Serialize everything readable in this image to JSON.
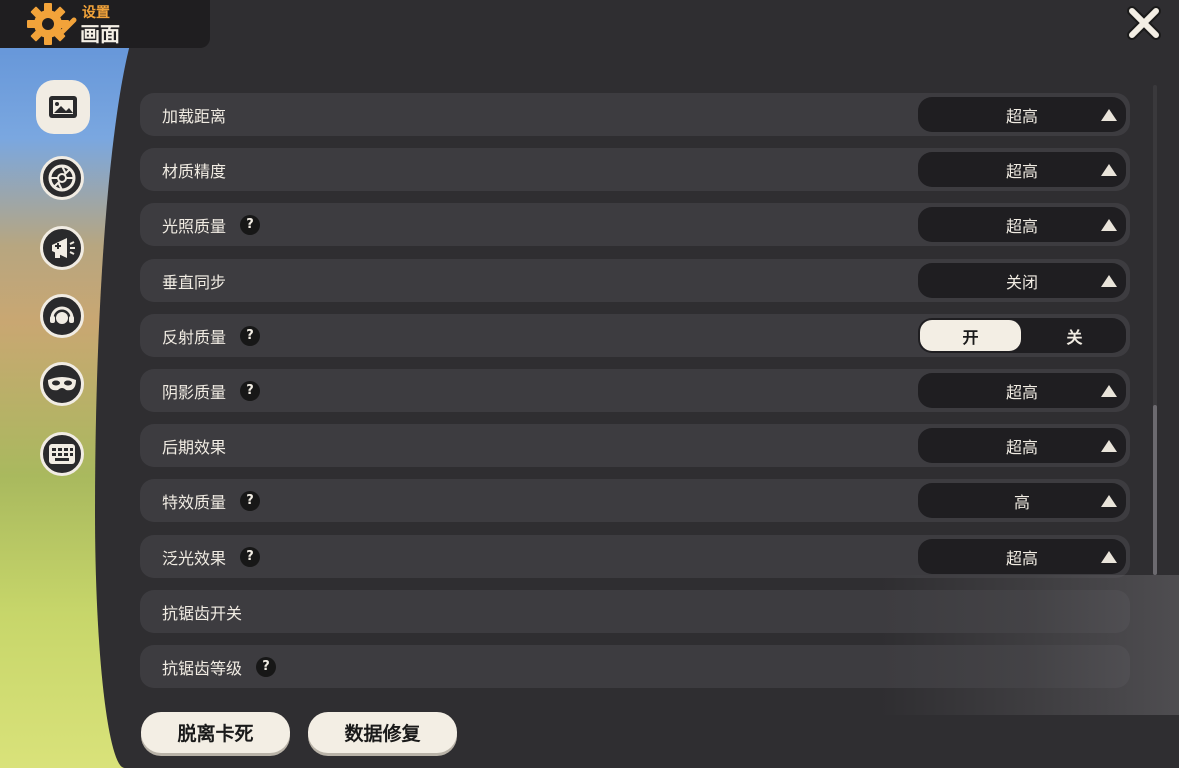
{
  "header": {
    "subtitle": "设置",
    "title": "画面"
  },
  "sidebar": {
    "items": [
      {
        "icon": "picture-icon",
        "active": true
      },
      {
        "icon": "aperture-icon",
        "active": false
      },
      {
        "icon": "megaphone-icon",
        "active": false
      },
      {
        "icon": "headset-icon",
        "active": false
      },
      {
        "icon": "mask-icon",
        "active": false
      },
      {
        "icon": "keyboard-icon",
        "active": false
      }
    ]
  },
  "settings": [
    {
      "label": "加载距离",
      "help": false,
      "type": "select",
      "value": "超高"
    },
    {
      "label": "材质精度",
      "help": false,
      "type": "select",
      "value": "超高"
    },
    {
      "label": "光照质量",
      "help": true,
      "type": "select",
      "value": "超高"
    },
    {
      "label": "垂直同步",
      "help": false,
      "type": "select",
      "value": "关闭"
    },
    {
      "label": "反射质量",
      "help": true,
      "type": "toggle",
      "on_label": "开",
      "off_label": "关",
      "selected": "开"
    },
    {
      "label": "阴影质量",
      "help": true,
      "type": "select",
      "value": "超高"
    },
    {
      "label": "后期效果",
      "help": false,
      "type": "select",
      "value": "超高"
    },
    {
      "label": "特效质量",
      "help": true,
      "type": "select",
      "value": "高"
    },
    {
      "label": "泛光效果",
      "help": true,
      "type": "select",
      "value": "超高"
    },
    {
      "label": "抗锯齿开关",
      "help": false,
      "type": "none"
    },
    {
      "label": "抗锯齿等级",
      "help": true,
      "type": "none"
    }
  ],
  "help_glyph": "?",
  "buttons": {
    "unstuck": "脱离卡死",
    "repair": "数据修复"
  },
  "colors": {
    "accent": "#f2a33a",
    "panel": "#2f2e31",
    "row": "#3d3c40",
    "control": "#1f1e21",
    "cream": "#f3eee4"
  }
}
